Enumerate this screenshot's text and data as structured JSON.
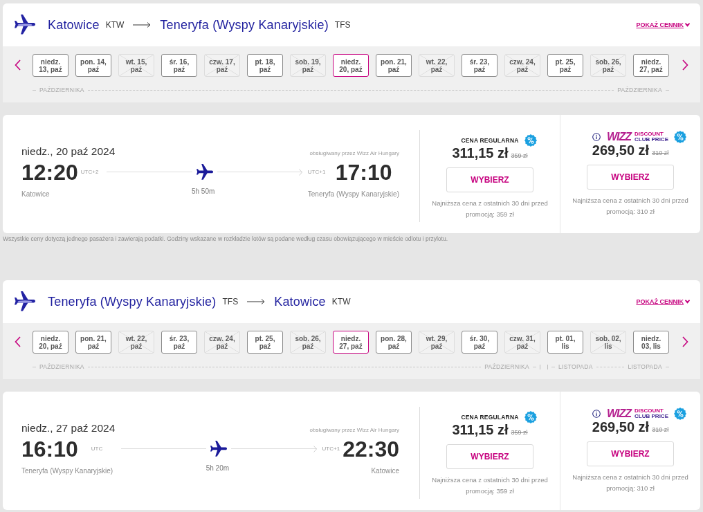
{
  "trips": [
    {
      "header": {
        "origin": "Katowice",
        "origin_code": "KTW",
        "destination": "Teneryfa (Wyspy Kanaryjskie)",
        "destination_code": "TFS",
        "price_link": "POKAŻ CENNIK"
      },
      "date_strip": {
        "months": [
          {
            "start_label": "PAŹDZIERNIKA",
            "end_label": "PAŹDZIERNIKA",
            "days": [
              {
                "label": "niedz.\n13, paź",
                "available": true,
                "selected": false
              },
              {
                "label": "pon. 14,\npaź",
                "available": true,
                "selected": false
              },
              {
                "label": "wt. 15,\npaź",
                "available": false,
                "selected": false
              },
              {
                "label": "śr. 16,\npaź",
                "available": true,
                "selected": false
              },
              {
                "label": "czw. 17,\npaź",
                "available": false,
                "selected": false
              },
              {
                "label": "pt. 18,\npaź",
                "available": true,
                "selected": false
              },
              {
                "label": "sob. 19,\npaź",
                "available": false,
                "selected": false
              },
              {
                "label": "niedz.\n20, paź",
                "available": true,
                "selected": true
              },
              {
                "label": "pon. 21,\npaź",
                "available": true,
                "selected": false
              },
              {
                "label": "wt. 22,\npaź",
                "available": false,
                "selected": false
              },
              {
                "label": "śr. 23,\npaź",
                "available": true,
                "selected": false
              },
              {
                "label": "czw. 24,\npaź",
                "available": false,
                "selected": false
              },
              {
                "label": "pt. 25,\npaź",
                "available": true,
                "selected": false
              },
              {
                "label": "sob. 26,\npaź",
                "available": false,
                "selected": false
              },
              {
                "label": "niedz.\n27, paź",
                "available": true,
                "selected": false
              }
            ]
          }
        ]
      },
      "flight": {
        "date": "niedz., 20 paź 2024",
        "operator": "obsługiwany przez Wizz Air Hungary",
        "departure": {
          "time": "12:20",
          "utc": "UTC+2",
          "city": "Katowice"
        },
        "duration": "5h 50m",
        "arrival": {
          "time": "17:10",
          "utc": "UTC+1",
          "city": "Teneryfa (Wyspy Kanaryjskie)"
        },
        "fares": [
          {
            "kind": "regular",
            "title": "CENA REGULARNA",
            "price": "311,15 zł",
            "old_price": "359 zł",
            "button": "WYBIERZ",
            "note": "Najniższa cena z ostatnich 30 dni przed promocją: 359 zł"
          },
          {
            "kind": "club",
            "logo": {
              "brand": "WIZZ",
              "line1": "DISCOUNT",
              "line2": "CLUB PRICE"
            },
            "price": "269,50 zł",
            "old_price": "310 zł",
            "button": "WYBIERZ",
            "note": "Najniższa cena z ostatnich 30 dni przed promocją: 310 zł"
          }
        ]
      },
      "footnote": "Wszystkie ceny dotyczą jednego pasażera i zawierają podatki. Godziny wskazane w rozkładzie lotów są podane według czasu obowiązującego w mieście odlotu i przylotu."
    },
    {
      "header": {
        "origin": "Teneryfa (Wyspy Kanaryjskie)",
        "origin_code": "TFS",
        "destination": "Katowice",
        "destination_code": "KTW",
        "price_link": "POKAŻ CENNIK"
      },
      "date_strip": {
        "months": [
          {
            "start_label": "PAŹDZIERNIKA",
            "end_label": "PAŹDZIERNIKA",
            "days": [
              {
                "label": "niedz.\n20, paź",
                "available": true,
                "selected": false
              },
              {
                "label": "pon. 21,\npaź",
                "available": true,
                "selected": false
              },
              {
                "label": "wt. 22,\npaź",
                "available": false,
                "selected": false
              },
              {
                "label": "śr. 23,\npaź",
                "available": true,
                "selected": false
              },
              {
                "label": "czw. 24,\npaź",
                "available": false,
                "selected": false
              },
              {
                "label": "pt. 25,\npaź",
                "available": true,
                "selected": false
              },
              {
                "label": "sob. 26,\npaź",
                "available": false,
                "selected": false
              },
              {
                "label": "niedz.\n27, paź",
                "available": true,
                "selected": true
              },
              {
                "label": "pon. 28,\npaź",
                "available": true,
                "selected": false
              },
              {
                "label": "wt. 29,\npaź",
                "available": false,
                "selected": false
              },
              {
                "label": "śr. 30,\npaź",
                "available": true,
                "selected": false
              },
              {
                "label": "czw. 31,\npaź",
                "available": false,
                "selected": false
              }
            ]
          },
          {
            "start_label": "LISTOPADA",
            "end_label": "LISTOPADA",
            "days": [
              {
                "label": "pt. 01,\nlis",
                "available": true,
                "selected": false
              },
              {
                "label": "sob. 02,\nlis",
                "available": false,
                "selected": false
              },
              {
                "label": "niedz.\n03, lis",
                "available": true,
                "selected": false
              }
            ]
          }
        ]
      },
      "flight": {
        "date": "niedz., 27 paź 2024",
        "operator": "obsługiwany przez Wizz Air Hungary",
        "departure": {
          "time": "16:10",
          "utc": "UTC",
          "city": "Teneryfa (Wyspy Kanaryjskie)"
        },
        "duration": "5h 20m",
        "arrival": {
          "time": "22:30",
          "utc": "UTC+1",
          "city": "Katowice"
        },
        "fares": [
          {
            "kind": "regular",
            "title": "CENA REGULARNA",
            "price": "311,15 zł",
            "old_price": "359 zł",
            "button": "WYBIERZ",
            "note": "Najniższa cena z ostatnich 30 dni przed promocją: 359 zł"
          },
          {
            "kind": "club",
            "logo": {
              "brand": "WIZZ",
              "line1": "DISCOUNT",
              "line2": "CLUB PRICE"
            },
            "price": "269,50 zł",
            "old_price": "310 zł",
            "button": "WYBIERZ",
            "note": "Najniższa cena z ostatnich 30 dni przed promocją: 310 zł"
          }
        ]
      }
    }
  ]
}
